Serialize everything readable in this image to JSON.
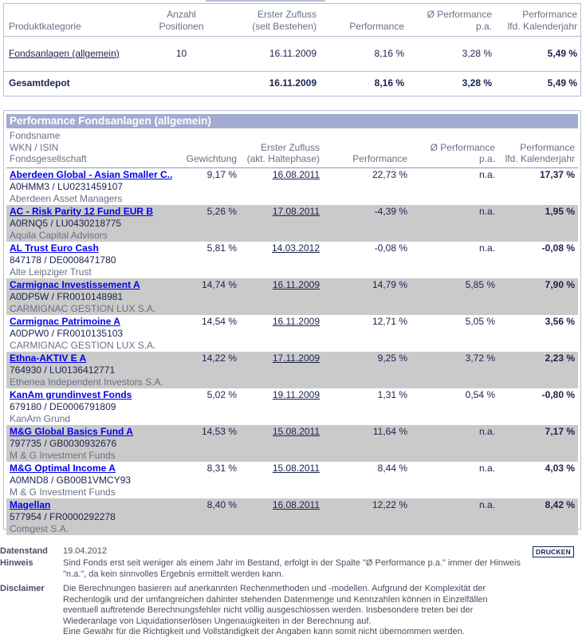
{
  "summary": {
    "headers": {
      "kategorie": "Produktkategorie",
      "anzahl_1": "Anzahl",
      "anzahl_2": "Positionen",
      "zufluss_1": "Erster Zufluss",
      "zufluss_2": "(seit Bestehen)",
      "performance": "Performance",
      "perf_pa_1": "Ø Performance",
      "perf_pa_2": "p.a.",
      "perf_kj_1": "Performance",
      "perf_kj_2": "lfd. Kalenderjahr"
    },
    "row": {
      "kategorie": "Fondsanlagen (allgemein)",
      "anzahl": "10",
      "zufluss": "16.11.2009",
      "performance": "8,16 %",
      "perf_pa": "3,28 %",
      "perf_kj": "5,49 %"
    },
    "total": {
      "label": "Gesamtdepot",
      "zufluss": "16.11.2009",
      "performance": "8,16 %",
      "perf_pa": "3,28 %",
      "perf_kj": "5,49 %"
    }
  },
  "performance_table": {
    "title": "Performance Fondsanlagen (allgemein)",
    "headers": {
      "name_1": "Fondsname",
      "name_2": "WKN / ISIN",
      "name_3": "Fondsgesellschaft",
      "gewichtung": "Gewichtung",
      "zufluss_1": "Erster Zufluss",
      "zufluss_2": "(akt. Haltephase)",
      "performance": "Performance",
      "perf_pa_1": "Ø Performance",
      "perf_pa_2": "p.a.",
      "perf_kj_1": "Performance",
      "perf_kj_2": "lfd. Kalenderjahr"
    },
    "rows": [
      {
        "name": "Aberdeen Global - Asian Smaller C...",
        "id": "A0HMM3 / LU0231459107",
        "company": "Aberdeen Asset Managers",
        "weight": "9,17 %",
        "date": "16.08.2011",
        "perf": "22,73 %",
        "perf_pa": "n.a.",
        "perf_kj": "17,37 %"
      },
      {
        "name": "AC - Risk Parity 12 Fund EUR B",
        "id": "A0RNQ5 / LU0430218775",
        "company": "Aquila Capital Advisors",
        "weight": "5,26 %",
        "date": "17.08.2011",
        "perf": "-4,39 %",
        "perf_pa": "n.a.",
        "perf_kj": "1,95 %"
      },
      {
        "name": "AL Trust Euro Cash",
        "id": "847178 / DE0008471780",
        "company": "Alte Leipziger Trust",
        "weight": "5,81 %",
        "date": "14.03.2012",
        "perf": "-0,08 %",
        "perf_pa": "n.a.",
        "perf_kj": "-0,08 %"
      },
      {
        "name": "Carmignac Investissement A",
        "id": "A0DP5W / FR0010148981",
        "company": "CARMIGNAC GESTION LUX S.A.",
        "weight": "14,74 %",
        "date": "16.11.2009",
        "perf": "14,79 %",
        "perf_pa": "5,85 %",
        "perf_kj": "7,90 %"
      },
      {
        "name": "Carmignac Patrimoine A",
        "id": "A0DPW0 / FR0010135103",
        "company": "CARMIGNAC GESTION LUX S.A.",
        "weight": "14,54 %",
        "date": "16.11.2009",
        "perf": "12,71 %",
        "perf_pa": "5,05 %",
        "perf_kj": "3,56 %"
      },
      {
        "name": "Ethna-AKTIV E A",
        "id": "764930 / LU0136412771",
        "company": "Ethenea Independent Investors S.A.",
        "weight": "14,22 %",
        "date": "17.11.2009",
        "perf": "9,25 %",
        "perf_pa": "3,72 %",
        "perf_kj": "2,23 %"
      },
      {
        "name": "KanAm grundinvest Fonds",
        "id": "679180 / DE0006791809",
        "company": "KanAm Grund",
        "weight": "5,02 %",
        "date": "19.11.2009",
        "perf": "1,31 %",
        "perf_pa": "0,54 %",
        "perf_kj": "-0,80 %"
      },
      {
        "name": "M&G Global Basics Fund A",
        "id": "797735 / GB0030932676",
        "company": "M & G Investment Funds",
        "weight": "14,53 %",
        "date": "15.08.2011",
        "perf": "11,64 %",
        "perf_pa": "n.a.",
        "perf_kj": "7,17 %"
      },
      {
        "name": "M&G Optimal Income A",
        "id": "A0MND8 / GB00B1VMCY93",
        "company": "M & G Investment Funds",
        "weight": "8,31 %",
        "date": "15.08.2011",
        "perf": "8,44 %",
        "perf_pa": "n.a.",
        "perf_kj": "4,03 %"
      },
      {
        "name": "Magellan",
        "id": "577954 / FR0000292278",
        "company": "Comgest S.A.",
        "weight": "8,40 %",
        "date": "16.08.2011",
        "perf": "12,22 %",
        "perf_pa": "n.a.",
        "perf_kj": "8,42 %"
      }
    ]
  },
  "footer": {
    "datenstand_label": "Datenstand",
    "datenstand_value": "19.04.2012",
    "hinweis_label": "Hinweis",
    "hinweis_text": "Sind Fonds erst seit weniger als einem Jahr im Bestand, erfolgt in der Spalte \"Ø Performance p.a.\" immer der Hinweis \"n.a.\", da kein sinnvolles Ergebnis ermittelt werden kann.",
    "disclaimer_label": "Disclaimer",
    "disclaimer_text": "Die Berechnungen basieren auf anerkannten Rechenmethoden und -modellen. Aufgrund der Komplexität der Rechenlogik und der umfangreichen dahinter stehenden Datenmenge und Kennzahlen können in Einzelfällen eventuell auftretende Berechnungsfehler nicht völlig ausgeschlossen werden. Insbesondere treten bei der Wiederanlage von Liquidationserlösen Ungenauigkeiten in der Berechnung auf.",
    "disclaimer_text_2": "Eine Gewähr für die Richtigkeit und Vollständigkeit der Angaben kann somit nicht übernommen werden.",
    "print_label": "DRUCKEN"
  }
}
